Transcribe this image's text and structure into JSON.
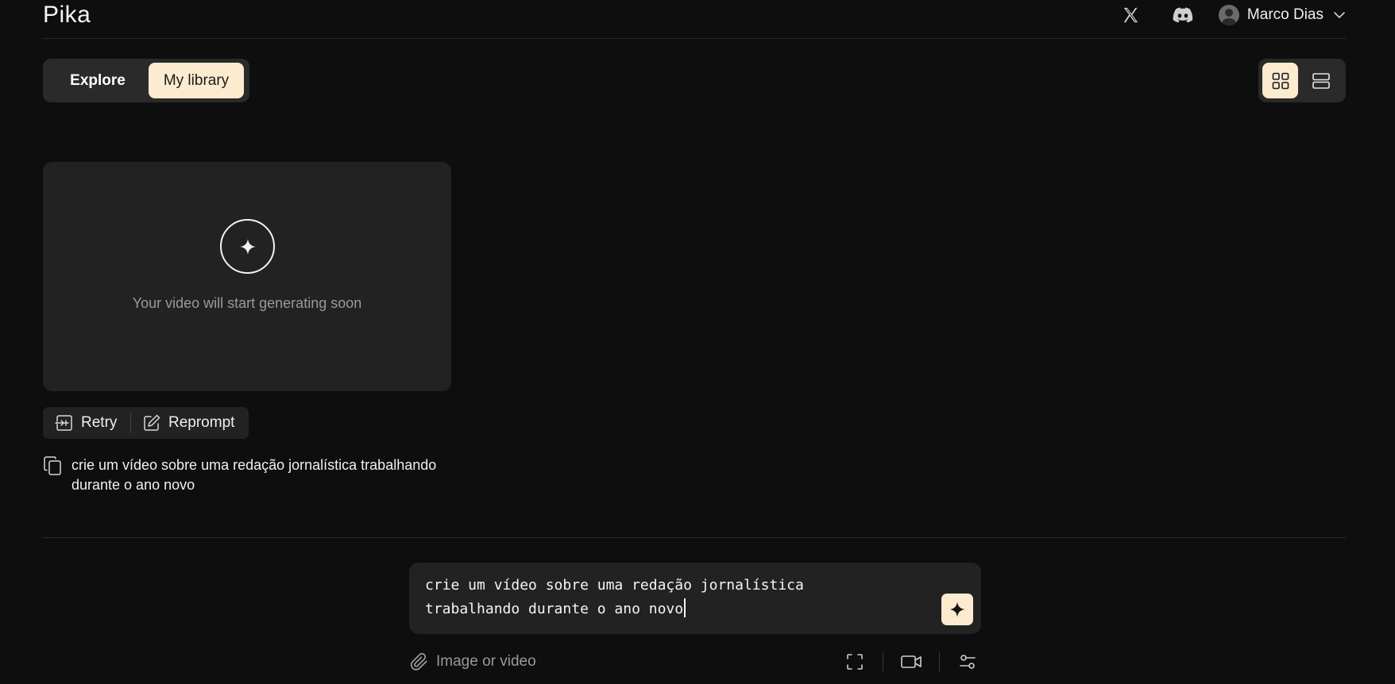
{
  "header": {
    "logo": "Pika",
    "user_name": "Marco Dias",
    "icons": [
      "x-icon",
      "discord-icon",
      "avatar",
      "chevron-down-icon"
    ]
  },
  "tabs": [
    {
      "label": "Explore",
      "active": false
    },
    {
      "label": "My library",
      "active": true
    }
  ],
  "view_toggle": {
    "active": "grid",
    "options": [
      "grid-view-icon",
      "list-view-icon"
    ]
  },
  "card": {
    "status_text": "Your video will start generating soon",
    "icon": "sparkle-icon"
  },
  "actions": {
    "retry_label": "Retry",
    "reprompt_label": "Reprompt"
  },
  "prompt": {
    "text": "crie um vídeo sobre uma redação jornalística trabalhando durante o ano novo"
  },
  "composer": {
    "value": "crie um vídeo sobre uma redação jornalística\ntrabalhando durante o ano novo",
    "attach_label": "Image or video",
    "tool_icons": [
      "aspect-ratio-icon",
      "camera-icon",
      "settings-sliders-icon"
    ]
  },
  "colors": {
    "background": "#0e0e0e",
    "surface": "#222222",
    "accent": "#fdebd0"
  }
}
